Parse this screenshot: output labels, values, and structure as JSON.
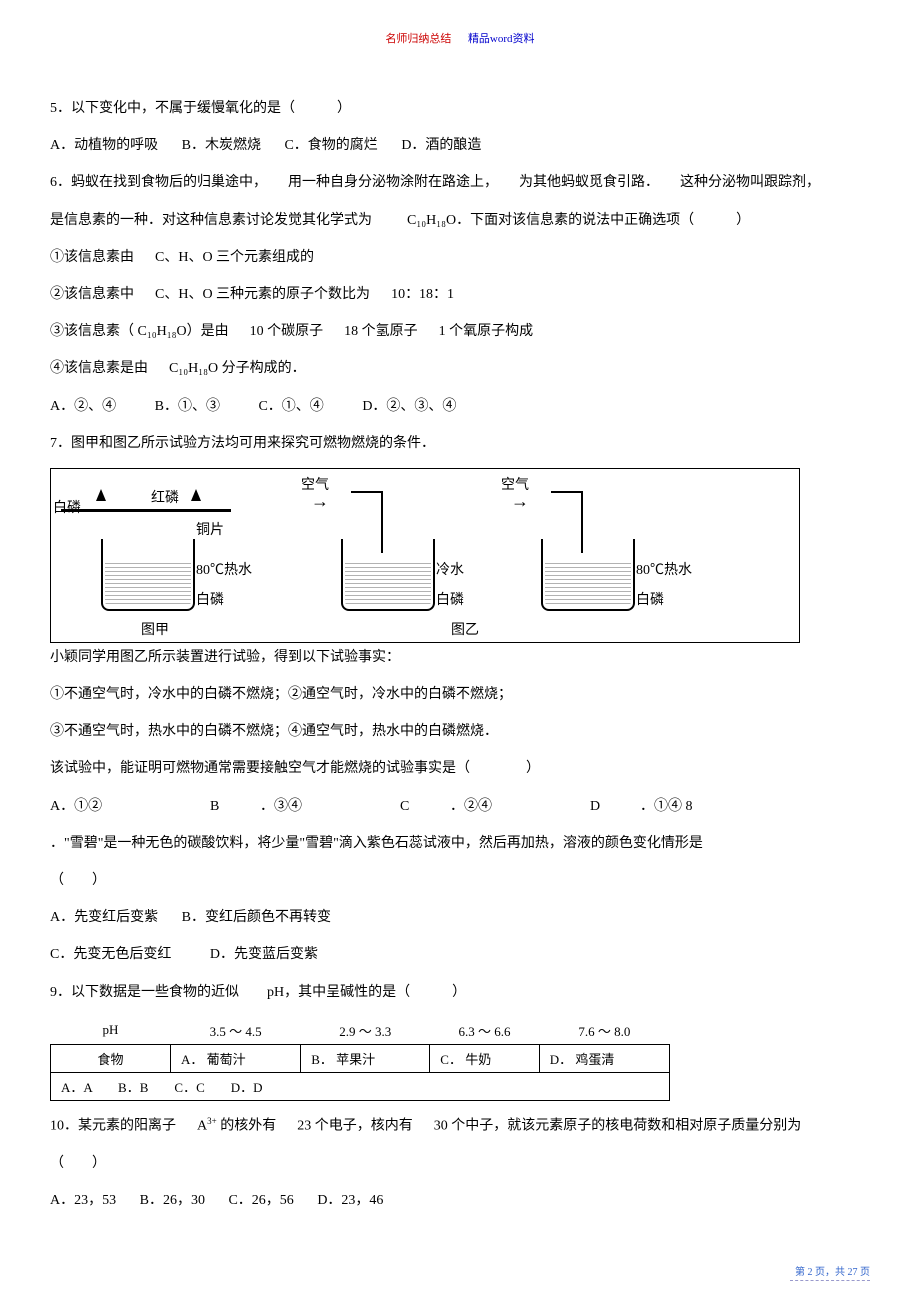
{
  "header": {
    "red": "名师归纳总结",
    "blue": "精品word资料"
  },
  "q5": {
    "stem": "5．以下变化中，不属于缓慢氧化的是（　　　）",
    "A": "A．动植物的呼吸",
    "B": "B．木炭燃烧",
    "C": "C．食物的腐烂",
    "D": "D．酒的酿造"
  },
  "q6": {
    "stem1": "6．蚂蚁在找到食物后的归巢途中，　　用一种自身分泌物涂附在路途上，　　为其他蚂蚁觅食引路．　　这种分泌物叫跟踪剂，",
    "stem2a": "是信息素的一种．对这种信息素讨论发觉其化学式为",
    "stem2b": "C₁₀H₁₈O．下面对该信息素的说法中正确选项（　　　）",
    "s1a": "①该信息素由",
    "s1b": "C、H、O 三个元素组成的",
    "s2a": "②该信息素中",
    "s2b": "C、H、O 三种元素的原子个数比为",
    "s2c": "10：18：1",
    "s3a": "③该信息素（",
    "s3b": "C₁₀H₁₈O）是由",
    "s3c": "10 个碳原子",
    "s3d": "18 个氢原子",
    "s3e": "1 个氧原子构成",
    "s4a": "④该信息素是由",
    "s4b": "C₁₀H₁₈O 分子构成的．",
    "optA": "A．②、④",
    "optB": "B．①、③",
    "optC": "C．①、④",
    "optD": "D．②、③、④"
  },
  "q7": {
    "stem": "7．图甲和图乙所示试验方法均可用来探究可燃物燃烧的条件．",
    "fig": {
      "hongLin": "红磷",
      "baiLin": "白磷",
      "tongPian": "铜片",
      "reShui80": "80℃热水",
      "lengShui": "冷水",
      "kongQi": "空气",
      "tuJia": "图甲",
      "tuYi": "图乙"
    },
    "post1": "小颖同学用图乙所示装置进行试验，得到以下试验事实：",
    "post2": "①不通空气时，冷水中的白磷不燃烧；②通空气时，冷水中的白磷不燃烧；",
    "post3": "③不通空气时，热水中的白磷不燃烧；④通空气时，热水中的白磷燃烧．",
    "post4": "该试验中，能证明可燃物通常需要接触空气才能燃烧的试验事实是（　　　　）",
    "optA": "A．①②",
    "optB": "B",
    "optBv": "．③④",
    "optC": "C",
    "optCv": "．②④",
    "optD": "D",
    "optDv": "．①④ 8"
  },
  "q8": {
    "stem": "．\"雪碧\"是一种无色的碳酸饮料，将少量\"雪碧\"滴入紫色石蕊试液中，然后再加热，溶液的颜色变化情形是",
    "paren": "（　　）",
    "A": "A．先变红后变紫",
    "B": "B．变红后颜色不再转变",
    "C": "C．先变无色后变红",
    "D": "D．先变蓝后变紫"
  },
  "q9": {
    "stem": "9．以下数据是一些食物的近似　　pH，其中呈碱性的是（　　　）",
    "rowPH": {
      "h": "pH",
      "a": "3.5 ～ 4.5",
      "b": "2.9 ～ 3.3",
      "c": "6.3 ～ 6.6",
      "d": "7.6 ～ 8.0"
    },
    "rowFood": {
      "h": "食物",
      "a": "A． 葡萄汁",
      "b": "B． 苹果汁",
      "c": "C． 牛奶",
      "d": "D． 鸡蛋清"
    },
    "opts": "A．A　　B．B　　C．C　　D．D"
  },
  "q10": {
    "stem1a": "10．某元素的阳离子",
    "stem1b": "A",
    "stem1sup": "3+",
    "stem1c": "的核外有",
    "stem1d": "23 个电子，核内有",
    "stem1e": "30 个中子，就该元素原子的核电荷数和相对原子质量分别为",
    "paren": "（　　）",
    "A": "A．23，53",
    "B": "B．26，30",
    "C": "C．26，56",
    "D": "D．23，46"
  },
  "footer": {
    "page": "第 2 页，共 27 页"
  }
}
